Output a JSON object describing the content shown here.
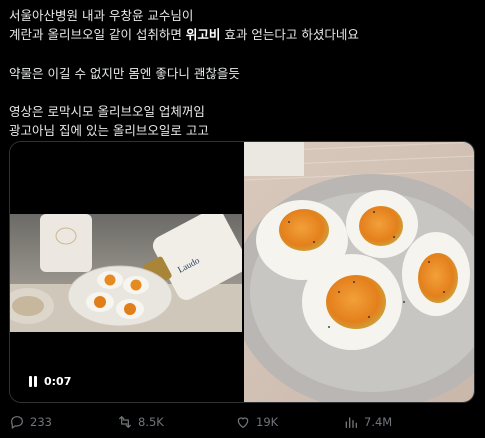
{
  "tweet": {
    "lines": [
      "서울아산병원 내과 우창윤 교수님이",
      [
        "계란과 올리브오일 같이 섭취하면 ",
        "위고비",
        " 효과 얻는다고 하셨다네요"
      ],
      "",
      "약물은 이길 수 없지만 몸엔 좋다니 괜찮을듯",
      "",
      "영상은 로막시모 올리브오일 업체꺼임",
      "광고아님 집에 있는 올리브오일로 고고"
    ],
    "line1": "서울아산병원 내과 우창윤 교수님이",
    "line2_pre": "계란과 올리브오일 같이 섭취하면 ",
    "line2_highlight": "위고비",
    "line2_post": " 효과 얻는다고 하셨다네요",
    "line3": "약물은 이길 수 없지만 몸엔 좋다니 괜찮을듯",
    "line4": "영상은 로막시모 올리브오일 업체꺼임",
    "line5": "광고아님 집에 있는 올리브오일로 고고"
  },
  "video": {
    "timestamp": "0:07",
    "icon": "pause-icon"
  },
  "actions": {
    "replies": "233",
    "reposts": "8.5K",
    "likes": "19K",
    "views": "7.4M"
  },
  "colors": {
    "background": "#000000",
    "text": "#e7e9ea",
    "muted": "#71767b",
    "border": "#2f3336"
  }
}
